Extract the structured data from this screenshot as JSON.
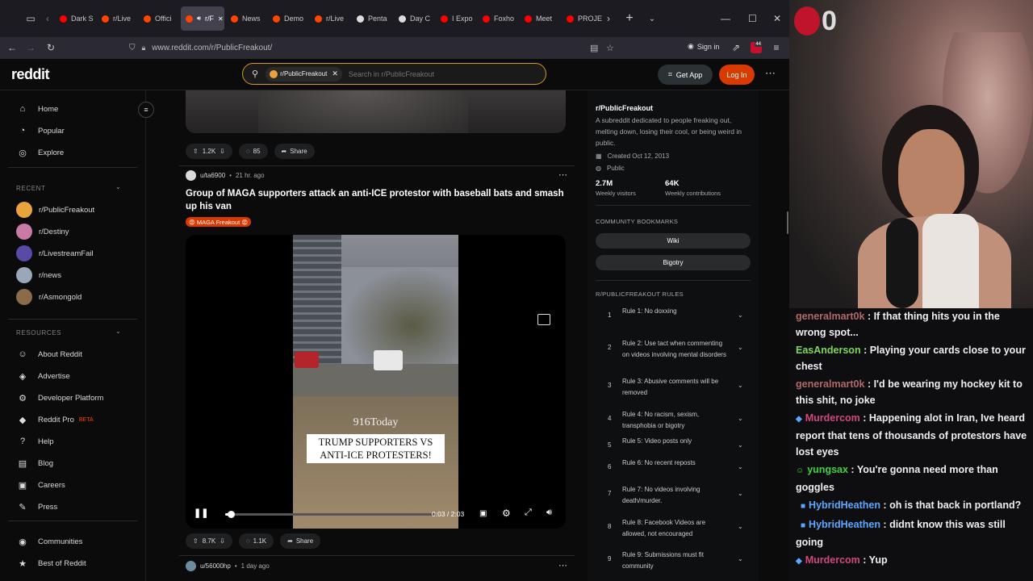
{
  "browser": {
    "tabs": [
      {
        "label": "Dark S",
        "color": "#ff0000"
      },
      {
        "label": "r/Live",
        "color": "#ff4500"
      },
      {
        "label": "Offici",
        "color": "#ff4500"
      },
      {
        "label": "r/F",
        "color": "#ff4500",
        "active": true
      },
      {
        "label": "News",
        "color": "#ff4500"
      },
      {
        "label": "Demo",
        "color": "#ff4500"
      },
      {
        "label": "r/Live",
        "color": "#ff4500"
      },
      {
        "label": "Penta",
        "color": "#dddddd"
      },
      {
        "label": "Day C",
        "color": "#dddddd"
      },
      {
        "label": "I Expo",
        "color": "#ff0000"
      },
      {
        "label": "Foxho",
        "color": "#ff0000"
      },
      {
        "label": "Meet",
        "color": "#ff0000"
      },
      {
        "label": "PROJE",
        "color": "#ff0000"
      }
    ],
    "url": "www.reddit.com/r/PublicFreakout/",
    "sign_in": "Sign in",
    "ext_badge": "44"
  },
  "reddit": {
    "logo": "reddit",
    "search_chip": "r/PublicFreakout",
    "search_placeholder": "Search in r/PublicFreakout",
    "get_app": "Get App",
    "login": "Log In"
  },
  "sidebar": {
    "nav": [
      {
        "label": "Home",
        "icon": "home-icon"
      },
      {
        "label": "Popular",
        "icon": "popular-icon"
      },
      {
        "label": "Explore",
        "icon": "explore-icon"
      }
    ],
    "recent_label": "RECENT",
    "recent": [
      {
        "label": "r/PublicFreakout",
        "color": "#e8a33d"
      },
      {
        "label": "r/Destiny",
        "color": "#c97aa5"
      },
      {
        "label": "r/LivestreamFail",
        "color": "#5a4aa8"
      },
      {
        "label": "r/news",
        "color": "#9aa7b8"
      },
      {
        "label": "r/Asmongold",
        "color": "#8b6b4a"
      }
    ],
    "resources_label": "RESOURCES",
    "resources": [
      {
        "label": "About Reddit",
        "icon": "reddit-icon"
      },
      {
        "label": "Advertise",
        "icon": "advertise-icon"
      },
      {
        "label": "Developer Platform",
        "icon": "developer-icon"
      },
      {
        "label": "Reddit Pro",
        "icon": "pro-icon",
        "badge": "BETA"
      },
      {
        "label": "Help",
        "icon": "help-icon"
      },
      {
        "label": "Blog",
        "icon": "blog-icon"
      },
      {
        "label": "Careers",
        "icon": "careers-icon"
      },
      {
        "label": "Press",
        "icon": "press-icon"
      }
    ],
    "bottom": [
      {
        "label": "Communities",
        "icon": "communities-icon"
      },
      {
        "label": "Best of Reddit",
        "icon": "best-icon"
      }
    ]
  },
  "feed": {
    "prev_post": {
      "votes": "1.2K",
      "comments": "85",
      "share": "Share"
    },
    "post": {
      "author": "u/ta6900",
      "time": "21 hr. ago",
      "title": "Group of MAGA supporters attack an anti-ICE protestor with baseball bats and smash up his van",
      "flair": "MAGA Freakout",
      "video_watermark": "916Today",
      "video_caption": "TRUMP SUPPORTERS VS ANTI-ICE PROTESTERS!",
      "video_time": "0:03 / 2:03",
      "progress": 0.025,
      "votes": "8.7K",
      "comments": "1.1K",
      "share": "Share"
    },
    "next_post": {
      "author": "u/56000hp",
      "time": "1 day ago"
    }
  },
  "community": {
    "name": "r/PublicFreakout",
    "description": "A subreddit dedicated to people freaking out, melting down, losing their cool, or being weird in public.",
    "created": "Created Oct 12, 2013",
    "visibility": "Public",
    "stats": [
      {
        "value": "2.7M",
        "label": "Weekly visitors"
      },
      {
        "value": "64K",
        "label": "Weekly contributions"
      }
    ],
    "bookmarks_label": "COMMUNITY BOOKMARKS",
    "bookmarks": [
      "Wiki",
      "Bigotry"
    ],
    "rules_label": "R/PUBLICFREAKOUT RULES",
    "rules": [
      {
        "n": "1",
        "text": "Rule 1: No doxxing"
      },
      {
        "n": "2",
        "text": "Rule 2: Use tact when commenting on videos involving mental disorders"
      },
      {
        "n": "3",
        "text": "Rule 3: Abusive comments will be removed"
      },
      {
        "n": "4",
        "text": "Rule 4: No racism, sexism, transphobia or bigotry"
      },
      {
        "n": "5",
        "text": "Rule 5: Video posts only"
      },
      {
        "n": "6",
        "text": "Rule 6: No recent reposts"
      },
      {
        "n": "7",
        "text": "Rule 7: No videos involving death/murder."
      },
      {
        "n": "8",
        "text": "Rule 8: Facebook Videos are allowed, not encouraged"
      },
      {
        "n": "9",
        "text": "Rule 9: Submissions must fit community"
      }
    ]
  },
  "stream": {
    "overlay_count": "0",
    "chat": [
      {
        "user": "generalmart0k",
        "color": "#b26868",
        "text": "If that thing hits you in the wrong spot...",
        "badge": ""
      },
      {
        "user": "EasAnderson",
        "color": "#7ed957",
        "text": "Playing your cards close to your chest",
        "badge": ""
      },
      {
        "user": "generalmart0k",
        "color": "#b26868",
        "text": "I'd be wearing my hockey kit to this shit, no joke",
        "badge": ""
      },
      {
        "user": "Murdercom",
        "color": "#d0477e",
        "text": "Happening alot in Iran, Ive heard report that tens of thousands of protestors have lost eyes",
        "badge": "cube"
      },
      {
        "user": "yungsax",
        "color": "#3fd23f",
        "text": "You're gonna need more than goggles",
        "badge": "user"
      },
      {
        "user": "HybridHeathen",
        "color": "#5aa8ff",
        "text": "oh is that back in portland?",
        "badge": "sq"
      },
      {
        "user": "HybridHeathen",
        "color": "#5aa8ff",
        "text": "didnt know this was still going",
        "badge": "sq"
      },
      {
        "user": "Murdercom",
        "color": "#d0477e",
        "text": "Yup",
        "badge": "cube"
      }
    ]
  }
}
